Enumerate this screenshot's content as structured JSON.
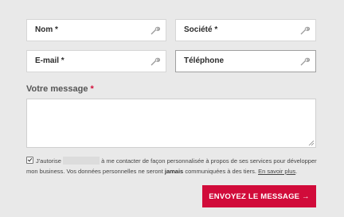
{
  "form": {
    "fields": {
      "nom": {
        "label": "Nom *"
      },
      "societe": {
        "label": "Société *"
      },
      "email": {
        "label": "E-mail *"
      },
      "telephone": {
        "label": "Téléphone"
      }
    },
    "message": {
      "label": "Votre message",
      "required_mark": "*"
    },
    "consent": {
      "checked": true,
      "text_before": "J'autorise",
      "text_after": "à me contacter de façon personnalisée à propos de ses services pour développer mon business. Vos données personnelles ne seront",
      "text_bold": "jamais",
      "text_end": "communiquées à des tiers.",
      "link": "En savoir plus",
      "period": "."
    },
    "submit_label": "ENVOYEZ LE MESSAGE →"
  },
  "colors": {
    "accent": "#d10b3a",
    "background": "#e9e9e9"
  },
  "icons": {
    "field_icon": "wrench-icon",
    "resize": "resize-grip-icon"
  }
}
